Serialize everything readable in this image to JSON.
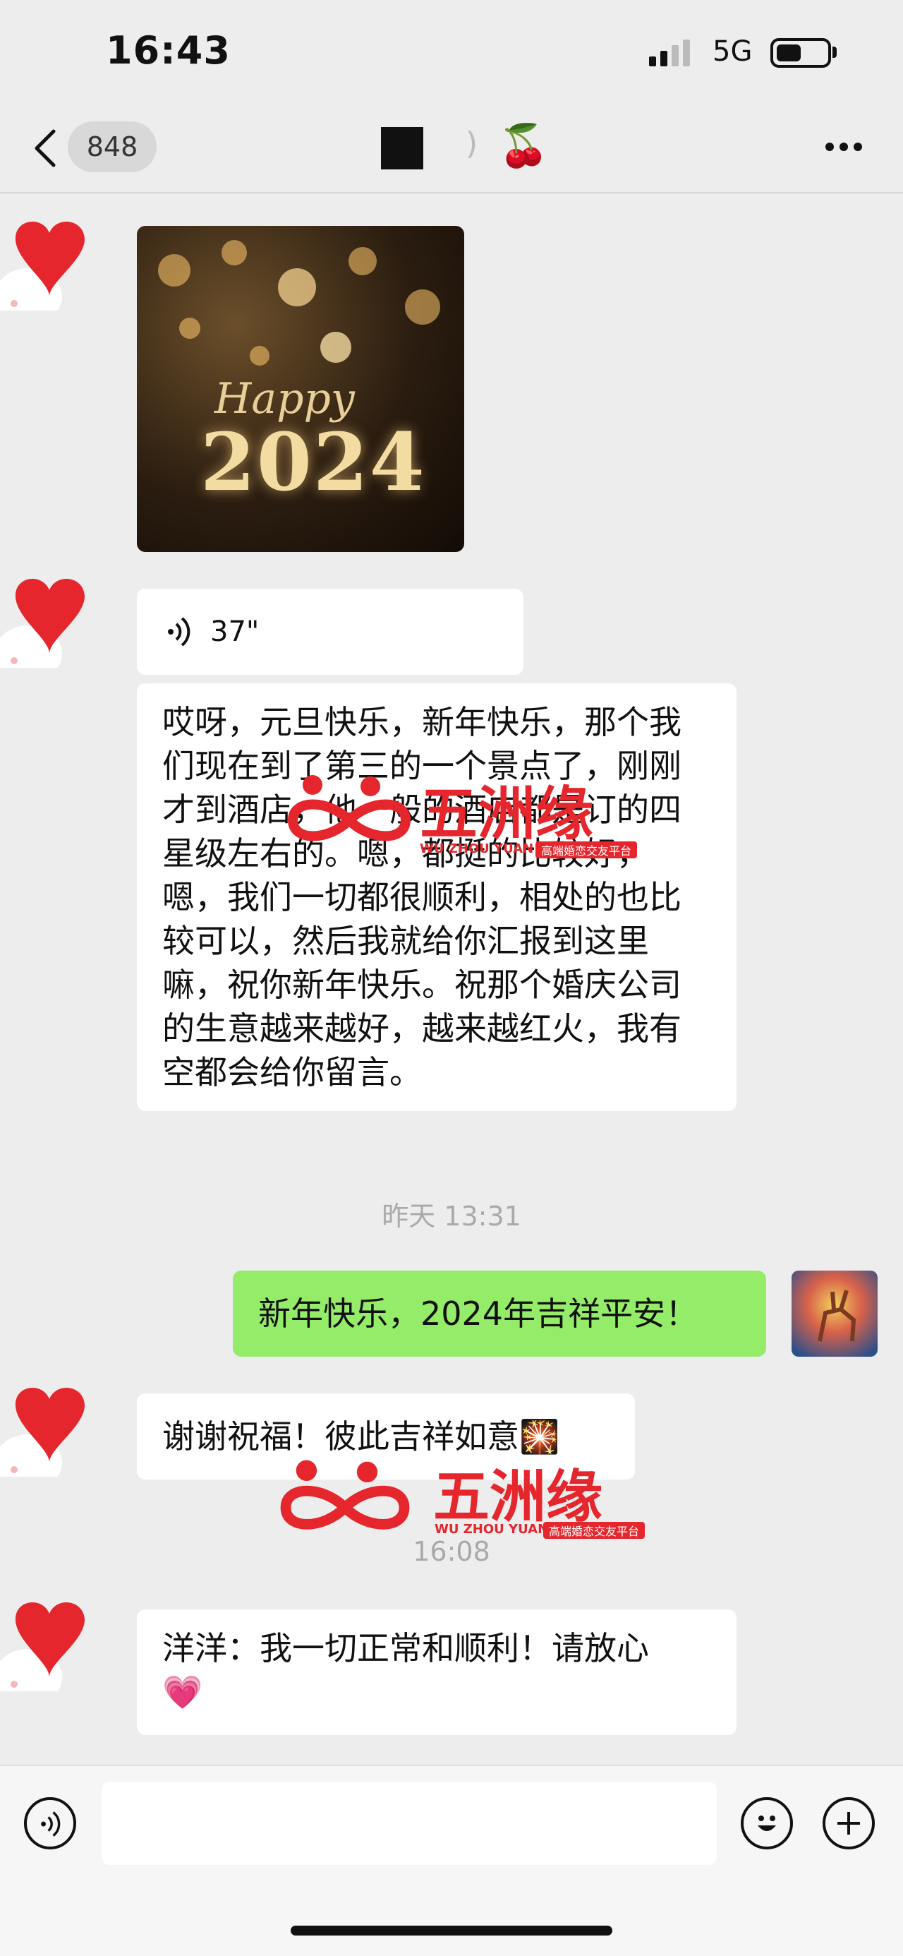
{
  "status_bar": {
    "time": "16:43",
    "network": "5G"
  },
  "nav": {
    "unread_count": "848",
    "title_suffix": ")",
    "title_emoji": "🍒"
  },
  "messages": {
    "voice_duration": "37\"",
    "long_text": "哎呀，元旦快乐，新年快乐，那个我们现在到了第三的一个景点了，刚刚才到酒店，他一般的酒店都是订的四星级左右的。嗯，都挺的比较好，嗯，我们一切都很顺利，相处的也比较可以，然后我就给你汇报到这里嘛，祝你新年快乐。祝那个婚庆公司的生意越来越好，越来越红火，我有空都会给你留言。",
    "timestamp_1": "昨天 13:31",
    "sent_text": "新年快乐，2024年吉祥平安！",
    "thanks_text": "谢谢祝福！彼此吉祥如意",
    "thanks_emoji": "🎇",
    "timestamp_2": "16:08",
    "last_text": "洋洋：我一切正常和顺利！请放心",
    "last_emoji": "💗"
  },
  "photo": {
    "line1": "Happy",
    "line2": "2024"
  },
  "watermark": {
    "brand": "五洲缘",
    "latin": "WU ZHOU YUAN",
    "tag": "高端婚恋交友平台"
  },
  "icons": {
    "back": "chevron-left-icon",
    "more": "more-dots-icon",
    "voice": "voice-wave-icon",
    "emoji": "smiley-icon",
    "plus": "plus-icon",
    "heart": "heart-icon"
  },
  "colors": {
    "sent_bubble": "#95ec69",
    "received_bubble": "#ffffff",
    "watermark": "#e5262c",
    "background": "#ededed"
  }
}
